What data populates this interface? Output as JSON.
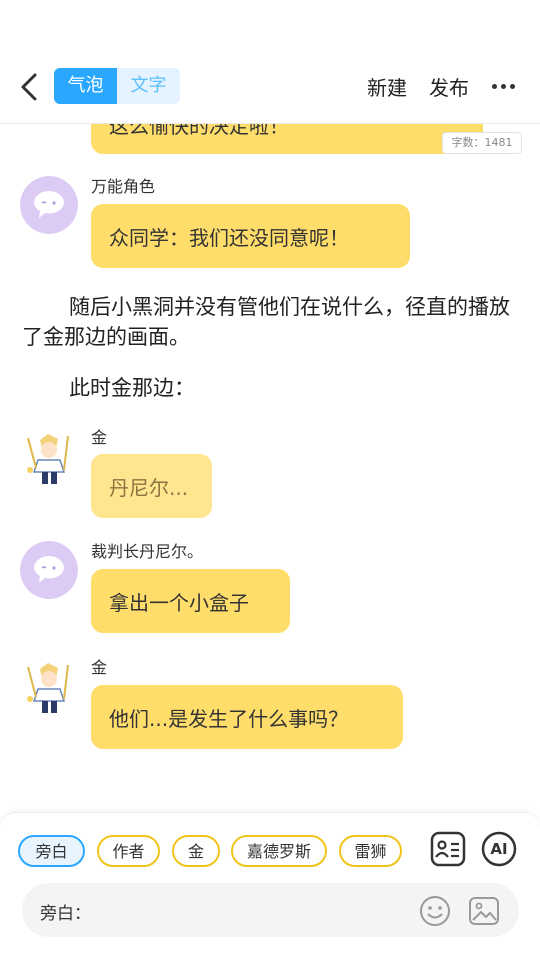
{
  "header": {
    "mode_active": "气泡",
    "mode_inactive": "文字",
    "new_label": "新建",
    "publish_label": "发布"
  },
  "chat": {
    "partial_bubble_text": "这么愉快的决定啦！",
    "word_count": "字数：1481",
    "msg1": {
      "speaker": "万能角色",
      "text": "众同学：我们还没同意呢！"
    },
    "narration1": "随后小黑洞并没有管他们在说什么，径直的播放了金那边的画面。",
    "narration2": "此时金那边：",
    "msg2": {
      "speaker": "金",
      "text": "丹尼尔..."
    },
    "msg3": {
      "speaker": "裁判长丹尼尔。",
      "text": "拿出一个小盒子"
    },
    "msg4": {
      "speaker": "金",
      "text": "他们...是发生了什么事吗？"
    }
  },
  "bottom": {
    "chips": [
      "旁白",
      "作者",
      "金",
      "嘉德罗斯",
      "雷狮"
    ],
    "ai_label": "AI",
    "input_label": "旁白："
  },
  "colors": {
    "accent": "#2aa8ff",
    "bubble": "#ffdd6b",
    "chip_border": "#f0c419"
  },
  "icons": [
    "back-arrow-icon",
    "more-dots-icon",
    "role-card-icon",
    "ai-icon",
    "emoji-icon",
    "image-icon"
  ]
}
